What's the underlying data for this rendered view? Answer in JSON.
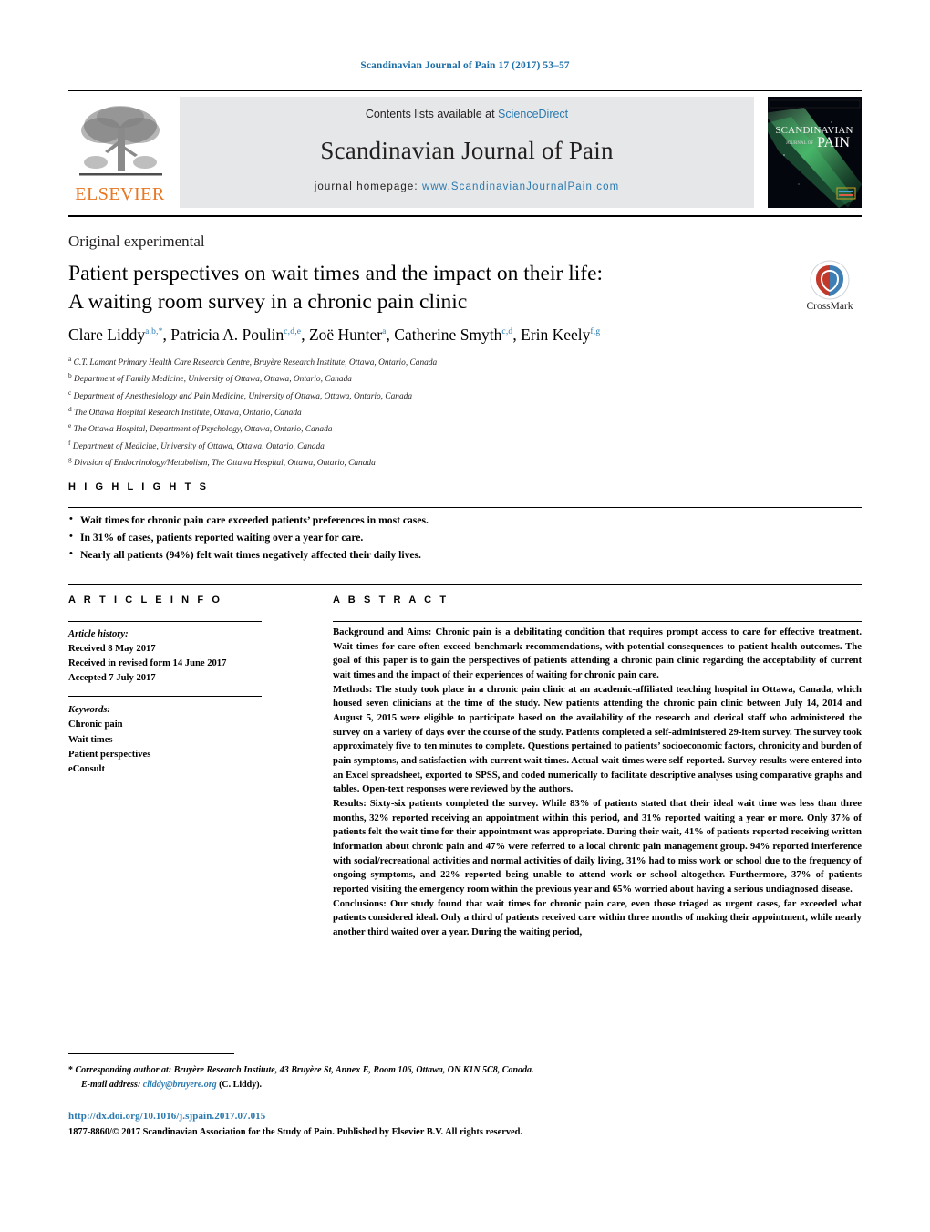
{
  "running_head": "Scandinavian Journal of Pain 17 (2017) 53–57",
  "masthead": {
    "contents_prefix": "Contents lists available at ",
    "sciencedirect": "ScienceDirect",
    "journal_title": "Scandinavian Journal of Pain",
    "homepage_prefix": "journal homepage: ",
    "homepage_url": "www.ScandinavianJournalPain.com",
    "publisher": "ELSEVIER",
    "cover_title_line1": "SCANDINAVIAN",
    "cover_title_line2": "JOURNAL OF",
    "cover_title_line3": "PAIN",
    "accent_orange": "#e87722",
    "link_blue": "#2a7ab0",
    "band_grey": "#e6e7e8"
  },
  "article_type": "Original experimental",
  "title": {
    "line1": "Patient perspectives on wait times and the impact on their life:",
    "line2": "A waiting room survey in a chronic pain clinic"
  },
  "crossmark": {
    "label": "CrossMark"
  },
  "authors": [
    {
      "name": "Clare Liddy",
      "sup": "a,b,*"
    },
    {
      "name": "Patricia A. Poulin",
      "sup": "c,d,e"
    },
    {
      "name": "Zoë Hunter",
      "sup": "a"
    },
    {
      "name": "Catherine Smyth",
      "sup": "c,d"
    },
    {
      "name": "Erin Keely",
      "sup": "f,g"
    }
  ],
  "affiliations": [
    {
      "mark": "a",
      "text": "C.T. Lamont Primary Health Care Research Centre, Bruyère Research Institute, Ottawa, Ontario, Canada"
    },
    {
      "mark": "b",
      "text": "Department of Family Medicine, University of Ottawa, Ottawa, Ontario, Canada"
    },
    {
      "mark": "c",
      "text": "Department of Anesthesiology and Pain Medicine, University of Ottawa, Ottawa, Ontario, Canada"
    },
    {
      "mark": "d",
      "text": "The Ottawa Hospital Research Institute, Ottawa, Ontario, Canada"
    },
    {
      "mark": "e",
      "text": "The Ottawa Hospital, Department of Psychology, Ottawa, Ontario, Canada"
    },
    {
      "mark": "f",
      "text": "Department of Medicine, University of Ottawa, Ottawa, Ontario, Canada"
    },
    {
      "mark": "g",
      "text": "Division of Endocrinology/Metabolism, The Ottawa Hospital, Ottawa, Ontario, Canada"
    }
  ],
  "highlights": {
    "heading": "H I G H L I G H T S",
    "items": [
      "Wait times for chronic pain care exceeded patients’ preferences in most cases.",
      "In 31% of cases, patients reported waiting over a year for care.",
      "Nearly all patients (94%) felt wait times negatively affected their daily lives."
    ]
  },
  "article_info": {
    "heading": "A R T I C L E   I N F O",
    "history_label": "Article history:",
    "history": [
      "Received 8 May 2017",
      "Received in revised form 14 June 2017",
      "Accepted 7 July 2017"
    ],
    "keywords_label": "Keywords:",
    "keywords": [
      "Chronic pain",
      "Wait times",
      "Patient perspectives",
      "eConsult"
    ]
  },
  "abstract": {
    "heading": "A B S T R A C T",
    "sections": [
      {
        "label": "Background and Aims:",
        "text": " Chronic pain is a debilitating condition that requires prompt access to care for effective treatment. Wait times for care often exceed benchmark recommendations, with potential consequences to patient health outcomes. The goal of this paper is to gain the perspectives of patients attending a chronic pain clinic regarding the acceptability of current wait times and the impact of their experiences of waiting for chronic pain care."
      },
      {
        "label": "Methods:",
        "text": " The study took place in a chronic pain clinic at an academic-affiliated teaching hospital in Ottawa, Canada, which housed seven clinicians at the time of the study. New patients attending the chronic pain clinic between July 14, 2014 and August 5, 2015 were eligible to participate based on the availability of the research and clerical staff who administered the survey on a variety of days over the course of the study. Patients completed a self-administered 29-item survey. The survey took approximately five to ten minutes to complete. Questions pertained to patients’ socioeconomic factors, chronicity and burden of pain symptoms, and satisfaction with current wait times. Actual wait times were self-reported. Survey results were entered into an Excel spreadsheet, exported to SPSS, and coded numerically to facilitate descriptive analyses using comparative graphs and tables. Open-text responses were reviewed by the authors."
      },
      {
        "label": "Results:",
        "text": " Sixty-six patients completed the survey. While 83% of patients stated that their ideal wait time was less than three months, 32% reported receiving an appointment within this period, and 31% reported waiting a year or more. Only 37% of patients felt the wait time for their appointment was appropriate. During their wait, 41% of patients reported receiving written information about chronic pain and 47% were referred to a local chronic pain management group. 94% reported interference with social/recreational activities and normal activities of daily living, 31% had to miss work or school due to the frequency of ongoing symptoms, and 22% reported being unable to attend work or school altogether. Furthermore, 37% of patients reported visiting the emergency room within the previous year and 65% worried about having a serious undiagnosed disease."
      },
      {
        "label": "Conclusions:",
        "text": " Our study found that wait times for chronic pain care, even those triaged as urgent cases, far exceeded what patients considered ideal. Only a third of patients received care within three months of making their appointment, while nearly another third waited over a year. During the waiting period,"
      }
    ]
  },
  "footer": {
    "corresponding_marker": "*",
    "corresponding_text": "Corresponding author at: Bruyère Research Institute, 43 Bruyère St, Annex E, Room 106, Ottawa, ON K1N 5C8, Canada.",
    "email_label": "E-mail address:",
    "email": "cliddy@bruyere.org",
    "email_owner": "(C. Liddy).",
    "doi": "http://dx.doi.org/10.1016/j.sjpain.2017.07.015",
    "copyright": "1877-8860/© 2017 Scandinavian Association for the Study of Pain. Published by Elsevier B.V. All rights reserved."
  }
}
